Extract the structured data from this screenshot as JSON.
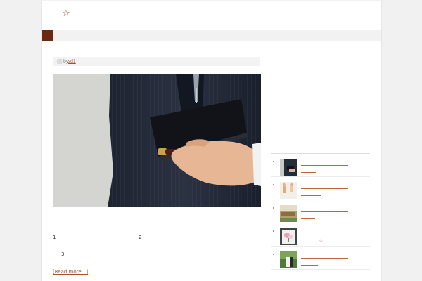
{
  "header": {
    "star_glyph": "☆"
  },
  "post": {
    "meta": {
      "by_label": "by",
      "author": "sd1"
    },
    "excerpt": {
      "num1": "1",
      "num2": "2",
      "num3": "3"
    },
    "read_more": "[Read more...]"
  },
  "sidebar": {
    "items": [
      {
        "thumb": "business-suit-thumbnail",
        "star": ""
      },
      {
        "thumb": "women-dresses-thumbnail",
        "star": ""
      },
      {
        "thumb": "venue-hall-thumbnail",
        "star": ""
      },
      {
        "thumb": "flower-bouquet-thumbnail",
        "star": "☆"
      },
      {
        "thumb": "wedding-couple-thumbnail",
        "star": ""
      }
    ]
  },
  "colors": {
    "accent": "#6b2a0f",
    "link": "#a0522d",
    "background": "#f1f1f1"
  }
}
